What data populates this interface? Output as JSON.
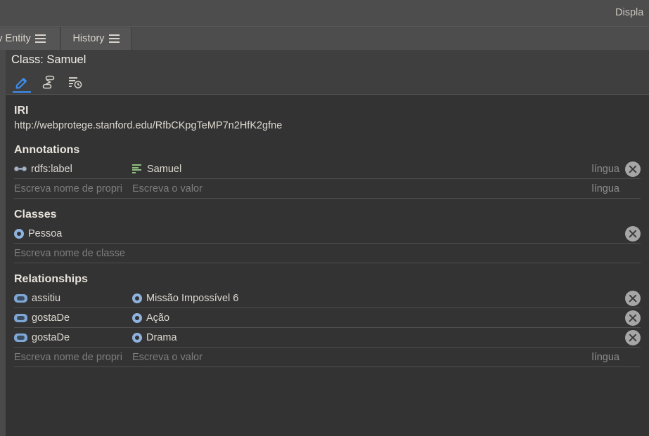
{
  "topbar": {
    "display_label": "Displa"
  },
  "tabs": [
    {
      "label": "y Entity",
      "icon": "hamburger-icon",
      "active": false
    },
    {
      "label": "History",
      "icon": "hamburger-icon",
      "active": false
    }
  ],
  "entity_header": {
    "title": "Class: Samuel"
  },
  "tool_tabs": [
    {
      "name": "edit-pencil-icon",
      "active": true
    },
    {
      "name": "class-hierarchy-icon",
      "active": false
    },
    {
      "name": "history-clock-icon",
      "active": false
    }
  ],
  "iri": {
    "title": "IRI",
    "value": "http://webprotege.stanford.edu/RfbCKpgTeMP7n2HfK2gfne"
  },
  "annotations": {
    "title": "Annotations",
    "rows": [
      {
        "property": "rdfs:label",
        "property_icon": "annotation-property-icon",
        "value": "Samuel",
        "value_icon": "literal-icon",
        "lang": "língua"
      }
    ],
    "new_row": {
      "property_placeholder": "Escreva nome de propri",
      "value_placeholder": "Escreva o valor",
      "lang_placeholder": "língua"
    }
  },
  "classes": {
    "title": "Classes",
    "rows": [
      {
        "name": "Pessoa",
        "icon": "class-icon"
      }
    ],
    "new_row": {
      "placeholder": "Escreva nome de classe"
    }
  },
  "relationships": {
    "title": "Relationships",
    "rows": [
      {
        "property": "assitiu",
        "property_icon": "object-property-icon",
        "value": "Missão Impossível 6",
        "value_icon": "class-icon"
      },
      {
        "property": "gostaDe",
        "property_icon": "object-property-icon",
        "value": "Ação",
        "value_icon": "class-icon"
      },
      {
        "property": "gostaDe",
        "property_icon": "object-property-icon",
        "value": "Drama",
        "value_icon": "class-icon"
      }
    ],
    "new_row": {
      "property_placeholder": "Escreva nome de propri",
      "value_placeholder": "Escreva o valor",
      "lang_placeholder": "língua"
    }
  },
  "colors": {
    "accent_blue": "#3b8ef0",
    "panel_bg": "#333333",
    "chrome_bg": "#4d4d4d",
    "literal_green": "#8fbf7f",
    "entity_blue": "#8fb2de"
  }
}
